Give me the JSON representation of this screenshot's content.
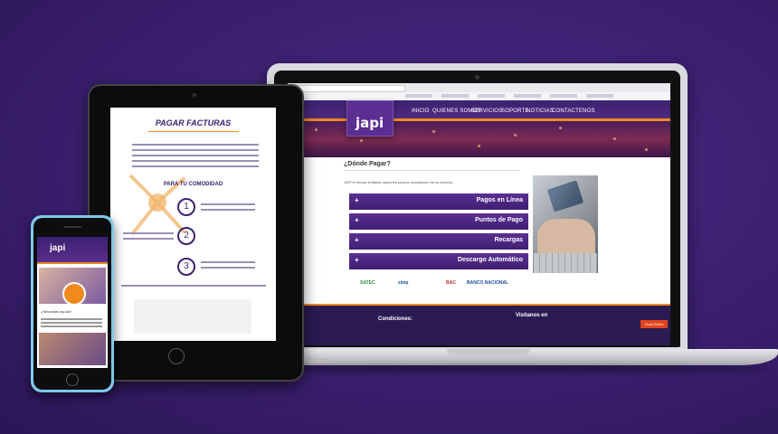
{
  "laptop": {
    "logo_text": "japi",
    "nav": [
      "INICIO",
      "QUIENES SOMOS",
      "SERVICIOS",
      "SOPORTE",
      "NOTICIAS",
      "CONTACTENOS"
    ],
    "page_title": "¿Dónde Pagar?",
    "description": "JAPI le brinda múltiples opciones para la cancelación de su servicio.",
    "payment_options": [
      "Pagos en Línea",
      "Puntos de Pago",
      "Recargas",
      "Descargo Automático"
    ],
    "partner_logos": [
      "SATEC",
      "zimp",
      "BAC",
      "BANCO NACIONAL"
    ],
    "footer": {
      "left_heading": "Condiciones:",
      "center_heading": "Visítanos en",
      "chat_label": "Chat Online"
    }
  },
  "tablet": {
    "title": "PAGAR FACTURAS",
    "subtitle": "PARA TU COMODIDAD",
    "steps": [
      "1",
      "2",
      "3"
    ]
  },
  "phone": {
    "logo_text": "japi",
    "question": "¿Necesitas ayuda?"
  }
}
